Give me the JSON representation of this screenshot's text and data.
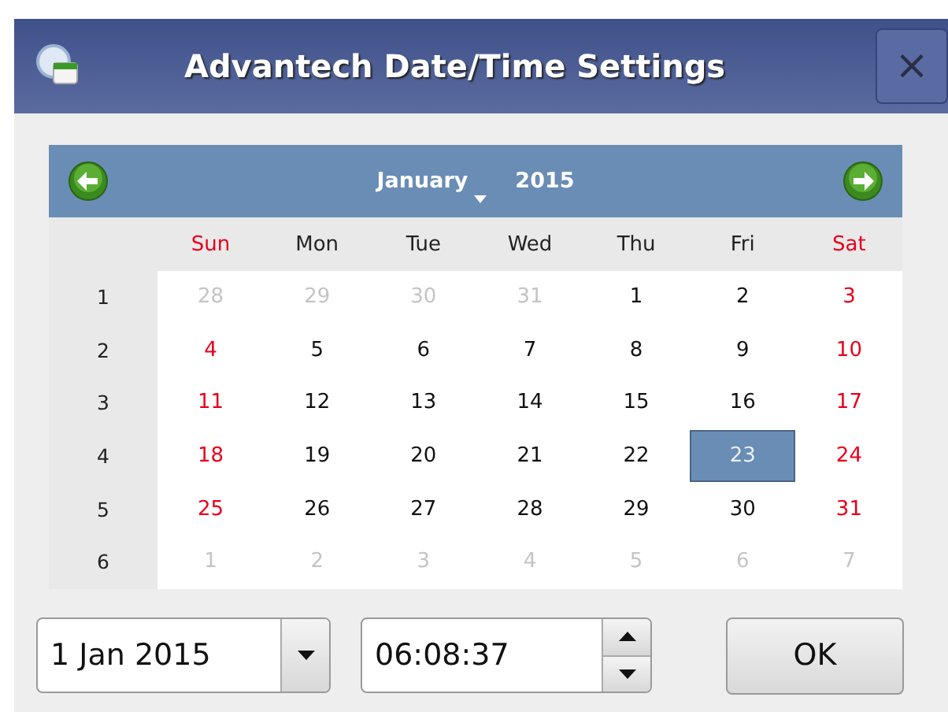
{
  "window": {
    "title": "Advantech Date/Time Settings",
    "close": "×"
  },
  "calendar": {
    "month": "January",
    "year": "2015",
    "weekdays": [
      {
        "label": "Sun",
        "kind": "weekend"
      },
      {
        "label": "Mon",
        "kind": "weekday"
      },
      {
        "label": "Tue",
        "kind": "weekday"
      },
      {
        "label": "Wed",
        "kind": "weekday"
      },
      {
        "label": "Thu",
        "kind": "weekday"
      },
      {
        "label": "Fri",
        "kind": "weekday"
      },
      {
        "label": "Sat",
        "kind": "weekend"
      }
    ],
    "weeks": [
      {
        "number": "1",
        "days": [
          {
            "label": "28",
            "kind": "other",
            "selected": false
          },
          {
            "label": "29",
            "kind": "other",
            "selected": false
          },
          {
            "label": "30",
            "kind": "other",
            "selected": false
          },
          {
            "label": "31",
            "kind": "other",
            "selected": false
          },
          {
            "label": "1",
            "kind": "weekday",
            "selected": false
          },
          {
            "label": "2",
            "kind": "weekday",
            "selected": false
          },
          {
            "label": "3",
            "kind": "weekend",
            "selected": false
          }
        ]
      },
      {
        "number": "2",
        "days": [
          {
            "label": "4",
            "kind": "weekend",
            "selected": false
          },
          {
            "label": "5",
            "kind": "weekday",
            "selected": false
          },
          {
            "label": "6",
            "kind": "weekday",
            "selected": false
          },
          {
            "label": "7",
            "kind": "weekday",
            "selected": false
          },
          {
            "label": "8",
            "kind": "weekday",
            "selected": false
          },
          {
            "label": "9",
            "kind": "weekday",
            "selected": false
          },
          {
            "label": "10",
            "kind": "weekend",
            "selected": false
          }
        ]
      },
      {
        "number": "3",
        "days": [
          {
            "label": "11",
            "kind": "weekend",
            "selected": false
          },
          {
            "label": "12",
            "kind": "weekday",
            "selected": false
          },
          {
            "label": "13",
            "kind": "weekday",
            "selected": false
          },
          {
            "label": "14",
            "kind": "weekday",
            "selected": false
          },
          {
            "label": "15",
            "kind": "weekday",
            "selected": false
          },
          {
            "label": "16",
            "kind": "weekday",
            "selected": false
          },
          {
            "label": "17",
            "kind": "weekend",
            "selected": false
          }
        ]
      },
      {
        "number": "4",
        "days": [
          {
            "label": "18",
            "kind": "weekend",
            "selected": false
          },
          {
            "label": "19",
            "kind": "weekday",
            "selected": false
          },
          {
            "label": "20",
            "kind": "weekday",
            "selected": false
          },
          {
            "label": "21",
            "kind": "weekday",
            "selected": false
          },
          {
            "label": "22",
            "kind": "weekday",
            "selected": false
          },
          {
            "label": "23",
            "kind": "weekday",
            "selected": true
          },
          {
            "label": "24",
            "kind": "weekend",
            "selected": false
          }
        ]
      },
      {
        "number": "5",
        "days": [
          {
            "label": "25",
            "kind": "weekend",
            "selected": false
          },
          {
            "label": "26",
            "kind": "weekday",
            "selected": false
          },
          {
            "label": "27",
            "kind": "weekday",
            "selected": false
          },
          {
            "label": "28",
            "kind": "weekday",
            "selected": false
          },
          {
            "label": "29",
            "kind": "weekday",
            "selected": false
          },
          {
            "label": "30",
            "kind": "weekday",
            "selected": false
          },
          {
            "label": "31",
            "kind": "weekend",
            "selected": false
          }
        ]
      },
      {
        "number": "6",
        "days": [
          {
            "label": "1",
            "kind": "other",
            "selected": false
          },
          {
            "label": "2",
            "kind": "other",
            "selected": false
          },
          {
            "label": "3",
            "kind": "other",
            "selected": false
          },
          {
            "label": "4",
            "kind": "other",
            "selected": false
          },
          {
            "label": "5",
            "kind": "other",
            "selected": false
          },
          {
            "label": "6",
            "kind": "other",
            "selected": false
          },
          {
            "label": "7",
            "kind": "other",
            "selected": false
          }
        ]
      }
    ]
  },
  "date_field": {
    "value": "1 Jan 2015"
  },
  "time_field": {
    "value": "06:08:37"
  },
  "buttons": [
    {
      "label": "OK"
    }
  ]
}
